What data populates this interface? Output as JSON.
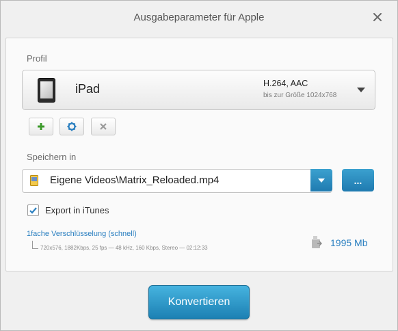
{
  "window": {
    "title": "Ausgabeparameter für Apple"
  },
  "profile": {
    "section_label": "Profil",
    "name": "iPad",
    "codec": "H.264, AAC",
    "size_limit": "bis zur Größe 1024x768",
    "icon": "ipad-icon"
  },
  "profile_actions": {
    "add_icon": "plus-icon",
    "settings_icon": "gear-icon",
    "delete_icon": "x-icon"
  },
  "save": {
    "section_label": "Speichern in",
    "path": "Eigene Videos\\Matrix_Reloaded.mp4",
    "browse_label": "..."
  },
  "itunes": {
    "label": "Export in iTunes",
    "checked": true
  },
  "encoding": {
    "mode_link": "1fache Verschlüsselung (schnell)",
    "details": "720x576, 1882Kbps, 25 fps — 48 kHz, 160 Kbps, Stereo — 02:12:33"
  },
  "output": {
    "size": "1995 Mb"
  },
  "convert_button": "Konvertieren",
  "colors": {
    "accent": "#2a7fc0",
    "button_blue": "#1f7ab0",
    "add_green": "#3c9a2a"
  }
}
